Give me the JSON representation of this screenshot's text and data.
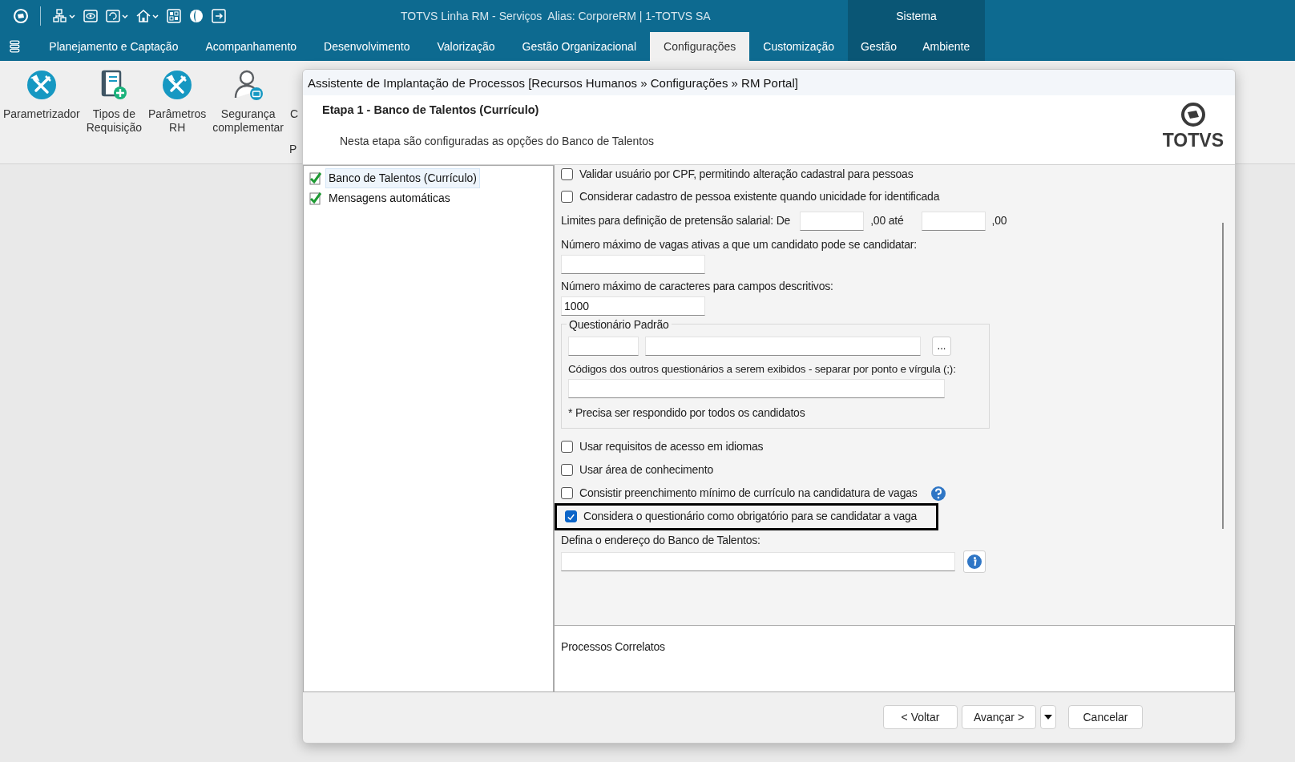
{
  "window": {
    "title": "TOTVS Linha RM - Serviços  Alias: CorporeRM | 1-TOTVS SA"
  },
  "menu": [
    {
      "label": "Planejamento e Captação",
      "selected": false
    },
    {
      "label": "Acompanhamento",
      "selected": false
    },
    {
      "label": "Desenvolvimento",
      "selected": false
    },
    {
      "label": "Valorização",
      "selected": false
    },
    {
      "label": "Gestão Organizacional",
      "selected": false
    },
    {
      "label": "Configurações",
      "selected": true
    },
    {
      "label": "Customização",
      "selected": false
    }
  ],
  "system_menu": {
    "label": "Sistema",
    "items": [
      {
        "label": "Gestão",
        "selected": false
      },
      {
        "label": "Ambiente",
        "selected": false
      }
    ]
  },
  "ribbon": {
    "items": [
      {
        "kind": "tools",
        "label": "Parametrizador"
      },
      {
        "kind": "document",
        "label": "Tipos de\nRequisição"
      },
      {
        "kind": "tools",
        "label": "Parâmetros\nRH"
      },
      {
        "kind": "user",
        "label": "Segurança\ncomplementar"
      },
      {
        "kind": "partial",
        "label": "C"
      }
    ],
    "group_label": "P"
  },
  "dialog": {
    "title": "Assistente de Implantação de Processos [Recursos Humanos » Configurações » RM Portal]",
    "step_title": "Etapa 1 - Banco de Talentos (Currículo)",
    "step_description": "Nesta etapa são configuradas as opções do Banco de Talentos",
    "logo_text": "TOTVS",
    "tree": [
      {
        "label": "Banco de Talentos (Currículo)",
        "selected": true
      },
      {
        "label": "Mensagens automáticas",
        "selected": false
      }
    ],
    "form": [
      {
        "kind": "checkbox",
        "label": "Validar usuário por CPF, permitindo alteração cadastral para pessoas",
        "checked": false,
        "highlighted": false,
        "help": false
      },
      {
        "kind": "checkbox",
        "label": "Considerar cadastro de pessoa existente quando unicidade for identificada",
        "checked": false,
        "highlighted": false,
        "help": false
      },
      {
        "kind": "range",
        "label": "Limites para definição de pretensão salarial: De",
        "from_suffix": ",00 até",
        "to_suffix": ",00"
      },
      {
        "kind": "field",
        "label": "Número máximo de vagas ativas a que um candidato pode se candidatar:",
        "info": false
      },
      {
        "kind": "field",
        "label": "Número máximo de caracteres para campos descritivos:",
        "value": "1000",
        "info": false
      },
      {
        "kind": "group",
        "title": "Questionário Padrão",
        "lookup_button": "...",
        "codes_label": "Códigos dos outros questionários a serem exibidos - separar por ponto e vírgula (;):",
        "note": "* Precisa ser respondido por todos os candidatos"
      },
      {
        "kind": "checkbox",
        "label": "Usar requisitos de acesso em idiomas",
        "checked": false,
        "highlighted": false,
        "help": false
      },
      {
        "kind": "checkbox",
        "label": "Usar área de conhecimento",
        "checked": false,
        "highlighted": false,
        "help": false
      },
      {
        "kind": "checkbox",
        "label": "Consistir preenchimento mínimo de currículo na candidatura de vagas",
        "checked": false,
        "highlighted": false,
        "help": true
      },
      {
        "kind": "checkbox",
        "label": "Considera o questionário como obrigatório para se candidatar a vaga",
        "checked": true,
        "highlighted": true,
        "help": false
      },
      {
        "kind": "field",
        "label": "Defina o endereço do Banco de Talentos:",
        "info": true
      }
    ],
    "related_processes_title": "Processos Correlatos",
    "buttons": [
      {
        "kind": "button",
        "label": "< Voltar"
      },
      {
        "kind": "button",
        "label": "Avançar >"
      },
      {
        "kind": "dropdown"
      },
      {
        "kind": "button",
        "label": "Cancelar"
      }
    ]
  }
}
